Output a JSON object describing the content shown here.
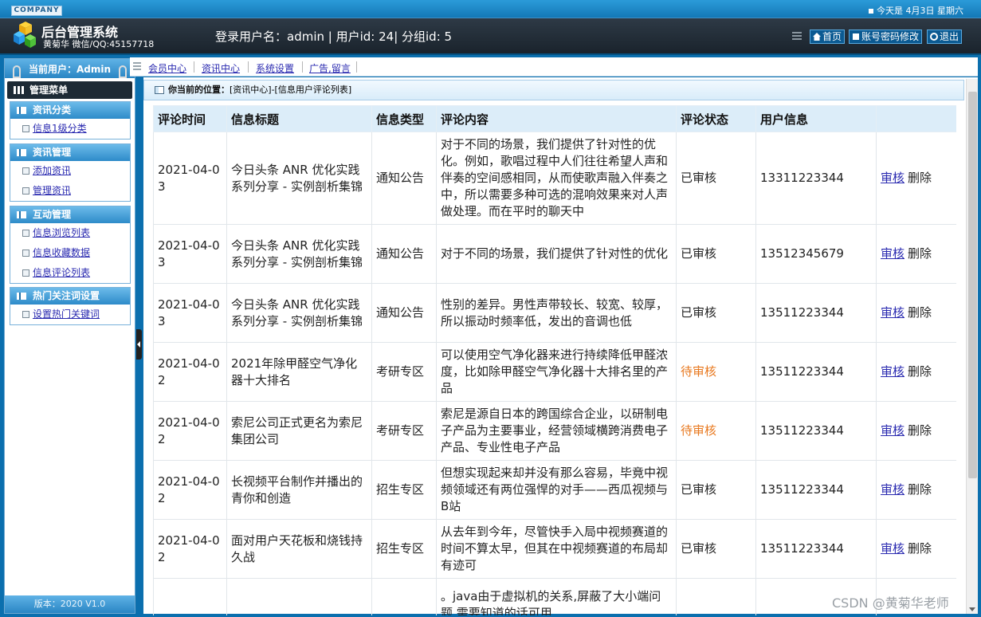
{
  "header": {
    "company": "COMPANY",
    "date_text": "今天是 4月3日 星期六",
    "system_title": "后台管理系统",
    "system_sub": "黄菊华 微信/QQ:45157718",
    "login_info": "登录用户名：admin | 用户id: 24| 分组id: 5",
    "buttons": {
      "home": "首页",
      "password": "账号密码修改",
      "logout": "退出"
    }
  },
  "sidebar": {
    "current_user": "当前用户：Admin",
    "menu_title": "管理菜单",
    "groups": [
      {
        "title": "资讯分类",
        "items": [
          "信息1级分类"
        ]
      },
      {
        "title": "资讯管理",
        "items": [
          "添加资讯",
          "管理资讯"
        ]
      },
      {
        "title": "互动管理",
        "items": [
          "信息浏览列表",
          "信息收藏数据",
          "信息评论列表"
        ]
      },
      {
        "title": "热门关注词设置",
        "items": [
          "设置热门关键词"
        ]
      }
    ],
    "version": "版本：2020 V1.0"
  },
  "nav": {
    "links": [
      "会员中心",
      "资讯中心",
      "系统设置",
      "广告,留言"
    ]
  },
  "location": {
    "label": "你当前的位置：",
    "path": "[资讯中心]-[信息用户评论列表]"
  },
  "table": {
    "headers": [
      "评论时间",
      "信息标题",
      "信息类型",
      "评论内容",
      "评论状态",
      "用户信息",
      ""
    ],
    "rows": [
      {
        "time": "2021-04-03",
        "title": "今日头条 ANR 优化实践系列分享 - 实例剖析集锦",
        "type": "通知公告",
        "content": "对于不同的场景，我们提供了针对性的优化。例如，歌唱过程中人们往往希望人声和伴奏的空间感相同，从而使歌声融入伴奏之中，所以需要多种可选的混响效果来对人声做处理。而在平时的聊天中",
        "status": "已审核",
        "status_pending": false,
        "user": "13311223344",
        "action": "审核",
        "delete": "删除"
      },
      {
        "time": "2021-04-03",
        "title": "今日头条 ANR 优化实践系列分享 - 实例剖析集锦",
        "type": "通知公告",
        "content": "对于不同的场景，我们提供了针对性的优化",
        "status": "已审核",
        "status_pending": false,
        "user": "13512345679",
        "action": "审核",
        "delete": "删除"
      },
      {
        "time": "2021-04-03",
        "title": "今日头条 ANR 优化实践系列分享 - 实例剖析集锦",
        "type": "通知公告",
        "content": "性别的差异。男性声带较长、较宽、较厚，所以振动时频率低，发出的音调也低",
        "status": "已审核",
        "status_pending": false,
        "user": "13511223344",
        "action": "审核",
        "delete": "删除"
      },
      {
        "time": "2021-04-02",
        "title": "2021年除甲醛空气净化器十大排名",
        "type": "考研专区",
        "content": "可以使用空气净化器来进行持续降低甲醛浓度，比如除甲醛空气净化器十大排名里的产品",
        "status": "待审核",
        "status_pending": true,
        "user": "13511223344",
        "action": "审核",
        "delete": "删除"
      },
      {
        "time": "2021-04-02",
        "title": "索尼公司正式更名为索尼集团公司",
        "type": "考研专区",
        "content": "索尼是源自日本的跨国综合企业，以研制电子产品为主要事业，经营领域横跨消费电子产品、专业性电子产品",
        "status": "待审核",
        "status_pending": true,
        "user": "13511223344",
        "action": "审核",
        "delete": "删除"
      },
      {
        "time": "2021-04-02",
        "title": "长视频平台制作并播出的青你和创造",
        "type": "招生专区",
        "content": "但想实现起来却并没有那么容易，毕竟中视频领域还有两位强悍的对手——西瓜视频与B站",
        "status": "已审核",
        "status_pending": false,
        "user": "13511223344",
        "action": "审核",
        "delete": "删除"
      },
      {
        "time": "2021-04-02",
        "title": "面对用户天花板和烧钱持久战",
        "type": "招生专区",
        "content": "从去年到今年，尽管快手入局中视频赛道的时间不算太早，但其在中视频赛道的布局却有迹可",
        "status": "已审核",
        "status_pending": false,
        "user": "13511223344",
        "action": "审核",
        "delete": "删除"
      },
      {
        "time": "",
        "title": "",
        "type": "",
        "content": "。java由于虚拟机的关系,屏蔽了大小端问题,需要知道的话可用",
        "status": "",
        "status_pending": false,
        "user": "",
        "action": "",
        "delete": ""
      }
    ]
  },
  "watermark": "CSDN @黄菊华老师",
  "colors": {
    "pending": "#e8781e",
    "link": "#2a2ab0",
    "header_bg": "#1a232c",
    "accent": "#2d8bc9"
  }
}
